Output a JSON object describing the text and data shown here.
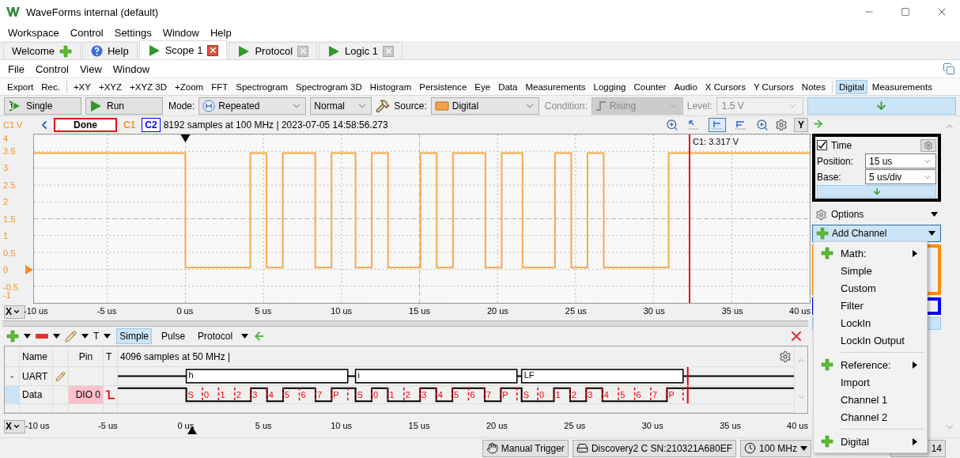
{
  "window": {
    "title": "WaveForms internal (default)"
  },
  "menu": [
    "Workspace",
    "Control",
    "Settings",
    "Window",
    "Help"
  ],
  "tabs": [
    {
      "label": "Welcome",
      "kind": "add",
      "selected": false
    },
    {
      "label": "Help",
      "kind": "help",
      "selected": false
    },
    {
      "label": "Scope 1",
      "kind": "instrument",
      "selected": true
    },
    {
      "label": "Protocol",
      "kind": "instrument",
      "selected": false
    },
    {
      "label": "Logic 1",
      "kind": "instrument",
      "selected": false
    }
  ],
  "instrument_menu": [
    "File",
    "Control",
    "View",
    "Window"
  ],
  "toolbar": {
    "file_items": [
      "Export",
      "Rec."
    ],
    "views": [
      "+XY",
      "+XYZ",
      "+XYZ 3D",
      "+Zoom",
      "FFT",
      "Spectrogram",
      "Spectrogram 3D",
      "Histogram",
      "Persistence",
      "Eye",
      "Data",
      "Measurements",
      "Logging",
      "Counter",
      "Audio",
      "X Cursors",
      "Y Cursors",
      "Notes"
    ],
    "panels": [
      {
        "label": "Digital",
        "selected": true
      },
      {
        "label": "Measurements",
        "selected": false
      }
    ]
  },
  "acquisition": {
    "single": "Single",
    "run": "Run",
    "mode_label": "Mode:",
    "mode": "Repeated",
    "trigger_type": "Normal",
    "source_label": "Source:",
    "source": "Digital",
    "condition_label": "Condition:",
    "condition": {
      "value": "Rising",
      "disabled": true
    },
    "level_label": "Level:",
    "level": {
      "value": "1.5 V",
      "disabled": true
    }
  },
  "status": {
    "unit": "C1 V",
    "state": "Done",
    "channels": [
      {
        "label": "C1",
        "color": "#f5901e",
        "selected": false
      },
      {
        "label": "C2",
        "color": "#0000ff",
        "selected": true
      }
    ],
    "info": "8192 samples at 100 MHz | 2023-07-05 14:58:56.273",
    "y_button": "Y"
  },
  "scope": {
    "y_labels": [
      "4",
      "3.5",
      "3",
      "2.5",
      "2",
      "1.5",
      "1",
      "0.5",
      "0",
      "-0.5",
      "-1"
    ],
    "x_labels": [
      "-10 us",
      "-5 us",
      "0 us",
      "5 us",
      "10 us",
      "15 us",
      "20 us",
      "25 us",
      "30 us",
      "35 us",
      "40 us"
    ],
    "cursor": "C1: 3.317 V",
    "x_button": "X"
  },
  "time_panel": {
    "title": "Time",
    "checked": true,
    "position_label": "Position:",
    "position": "15 us",
    "base_label": "Base:",
    "base": "5 us/div"
  },
  "options": "Options",
  "add_channel": "Add Channel",
  "add_menu": [
    [
      {
        "label": "Math:",
        "add_icon": true,
        "submenu": true
      },
      {
        "label": "Simple",
        "add_icon": false,
        "submenu": false
      },
      {
        "label": "Custom",
        "add_icon": false,
        "submenu": false
      },
      {
        "label": "Filter",
        "add_icon": false,
        "submenu": false
      },
      {
        "label": "LockIn",
        "add_icon": false,
        "submenu": false
      },
      {
        "label": "LockIn Output",
        "add_icon": false,
        "submenu": false
      }
    ],
    [
      {
        "label": "Reference:",
        "add_icon": true,
        "submenu": true
      },
      {
        "label": "Import",
        "add_icon": false,
        "submenu": false
      },
      {
        "label": "Channel 1",
        "add_icon": false,
        "submenu": false
      },
      {
        "label": "Channel 2",
        "add_icon": false,
        "submenu": false
      }
    ],
    [
      {
        "label": "Digital",
        "add_icon": true,
        "submenu": true
      }
    ]
  ],
  "logic": {
    "views": [
      {
        "label": "Simple",
        "selected": true
      },
      {
        "label": "Pulse",
        "selected": false
      },
      {
        "label": "Protocol",
        "selected": false
      }
    ],
    "t_label": "T",
    "columns": [
      "Name",
      "Pin",
      "T"
    ],
    "info": "4096 samples at 50 MHz |",
    "rows": [
      {
        "kind": "bus",
        "expander": "-",
        "name": "UART",
        "selected": false,
        "trigger": false,
        "frames": [
          "h",
          "i",
          "LF"
        ]
      },
      {
        "kind": "signal",
        "name": "Data",
        "selected": true,
        "pin": "DIO 0",
        "trigger": true,
        "bits": [
          [
            "S",
            "0",
            "1",
            "2",
            "3",
            "4",
            "5",
            "6",
            "7",
            "P"
          ],
          [
            "S",
            "0",
            "1",
            "2",
            "3",
            "4",
            "5",
            "6",
            "7",
            "P"
          ],
          [
            "S",
            "0",
            "1",
            "2",
            "3",
            "4",
            "5",
            "6",
            "7",
            "P"
          ]
        ]
      }
    ],
    "x_labels": [
      "-10 us",
      "-5 us",
      "0 us",
      "5 us",
      "10 us",
      "15 us",
      "20 us",
      "25 us",
      "30 us",
      "35 us",
      "40 us"
    ],
    "x_button": "X"
  },
  "status_bar": [
    {
      "label": "Manual Trigger",
      "kind": "trigger"
    },
    {
      "label": "Discovery2 C SN:210321A680EF",
      "kind": "device"
    },
    {
      "label": "100 MHz",
      "kind": "clock"
    },
    {
      "label": "14",
      "kind": "plain"
    }
  ]
}
